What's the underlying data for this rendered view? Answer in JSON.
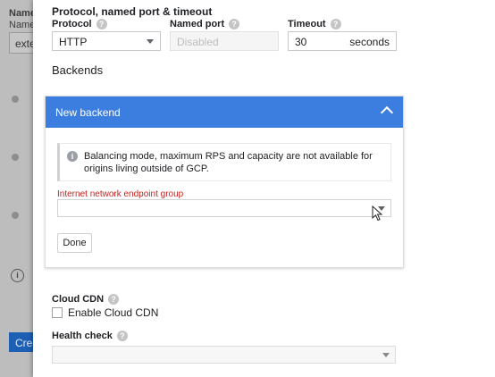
{
  "background": {
    "name_label": "Name",
    "name_sub_label": "Name",
    "name_value": "exte",
    "create_label": "Crea"
  },
  "section": {
    "title": "Protocol, named port & timeout"
  },
  "protocol": {
    "label": "Protocol",
    "value": "HTTP"
  },
  "named_port": {
    "label": "Named port",
    "placeholder": "Disabled"
  },
  "timeout": {
    "label": "Timeout",
    "value": "30",
    "unit": "seconds"
  },
  "backends": {
    "heading": "Backends",
    "card": {
      "title": "New backend",
      "notice": "Balancing mode, maximum RPS and capacity are not available for origins living outside of GCP.",
      "ineg_label": "Internet network endpoint group",
      "done_label": "Done"
    }
  },
  "cloud_cdn": {
    "label": "Cloud CDN",
    "checkbox_label": "Enable Cloud CDN"
  },
  "health_check": {
    "label": "Health check"
  },
  "icons": {
    "help": "?",
    "info": "i"
  },
  "colors": {
    "accent": "#3c7ee0",
    "error": "#c5221f",
    "create_button": "#1c5fb5"
  }
}
